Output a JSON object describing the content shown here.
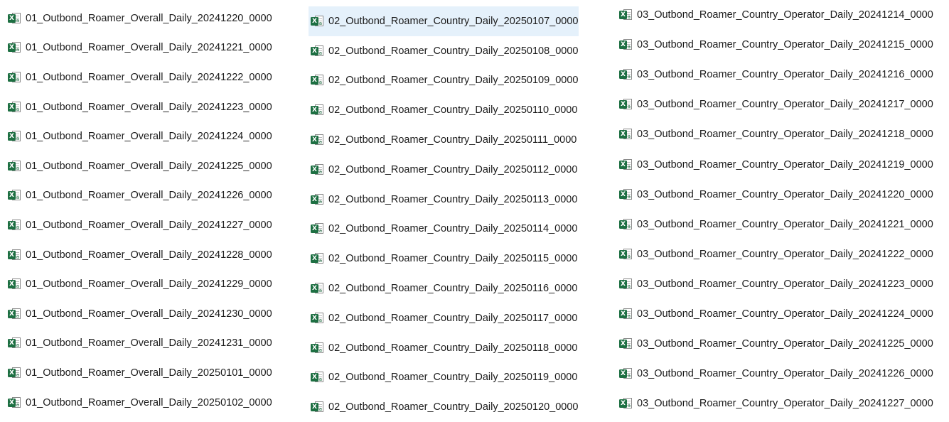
{
  "icons": {
    "file_type": "excel-csv-icon",
    "badge_letter": "X",
    "badge_color": "#1d6f42",
    "selection_color": "#e5f1fb"
  },
  "columns": [
    {
      "files": [
        "01_Outbond_Roamer_Overall_Daily_20241220_0000",
        "01_Outbond_Roamer_Overall_Daily_20241221_0000",
        "01_Outbond_Roamer_Overall_Daily_20241222_0000",
        "01_Outbond_Roamer_Overall_Daily_20241223_0000",
        "01_Outbond_Roamer_Overall_Daily_20241224_0000",
        "01_Outbond_Roamer_Overall_Daily_20241225_0000",
        "01_Outbond_Roamer_Overall_Daily_20241226_0000",
        "01_Outbond_Roamer_Overall_Daily_20241227_0000",
        "01_Outbond_Roamer_Overall_Daily_20241228_0000",
        "01_Outbond_Roamer_Overall_Daily_20241229_0000",
        "01_Outbond_Roamer_Overall_Daily_20241230_0000",
        "01_Outbond_Roamer_Overall_Daily_20241231_0000",
        "01_Outbond_Roamer_Overall_Daily_20250101_0000",
        "01_Outbond_Roamer_Overall_Daily_20250102_0000"
      ]
    },
    {
      "files": [
        "02_Outbond_Roamer_Country_Daily_20250107_0000",
        "02_Outbond_Roamer_Country_Daily_20250108_0000",
        "02_Outbond_Roamer_Country_Daily_20250109_0000",
        "02_Outbond_Roamer_Country_Daily_20250110_0000",
        "02_Outbond_Roamer_Country_Daily_20250111_0000",
        "02_Outbond_Roamer_Country_Daily_20250112_0000",
        "02_Outbond_Roamer_Country_Daily_20250113_0000",
        "02_Outbond_Roamer_Country_Daily_20250114_0000",
        "02_Outbond_Roamer_Country_Daily_20250115_0000",
        "02_Outbond_Roamer_Country_Daily_20250116_0000",
        "02_Outbond_Roamer_Country_Daily_20250117_0000",
        "02_Outbond_Roamer_Country_Daily_20250118_0000",
        "02_Outbond_Roamer_Country_Daily_20250119_0000",
        "02_Outbond_Roamer_Country_Daily_20250120_0000"
      ]
    },
    {
      "files": [
        "03_Outbond_Roamer_Country_Operator_Daily_20241214_0000",
        "03_Outbond_Roamer_Country_Operator_Daily_20241215_0000",
        "03_Outbond_Roamer_Country_Operator_Daily_20241216_0000",
        "03_Outbond_Roamer_Country_Operator_Daily_20241217_0000",
        "03_Outbond_Roamer_Country_Operator_Daily_20241218_0000",
        "03_Outbond_Roamer_Country_Operator_Daily_20241219_0000",
        "03_Outbond_Roamer_Country_Operator_Daily_20241220_0000",
        "03_Outbond_Roamer_Country_Operator_Daily_20241221_0000",
        "03_Outbond_Roamer_Country_Operator_Daily_20241222_0000",
        "03_Outbond_Roamer_Country_Operator_Daily_20241223_0000",
        "03_Outbond_Roamer_Country_Operator_Daily_20241224_0000",
        "03_Outbond_Roamer_Country_Operator_Daily_20241225_0000",
        "03_Outbond_Roamer_Country_Operator_Daily_20241226_0000",
        "03_Outbond_Roamer_Country_Operator_Daily_20241227_0000"
      ]
    }
  ],
  "selected": {
    "column": 1,
    "index": 0,
    "name": "02_Outbond_Roamer_Country_Daily_20250107_0000"
  }
}
